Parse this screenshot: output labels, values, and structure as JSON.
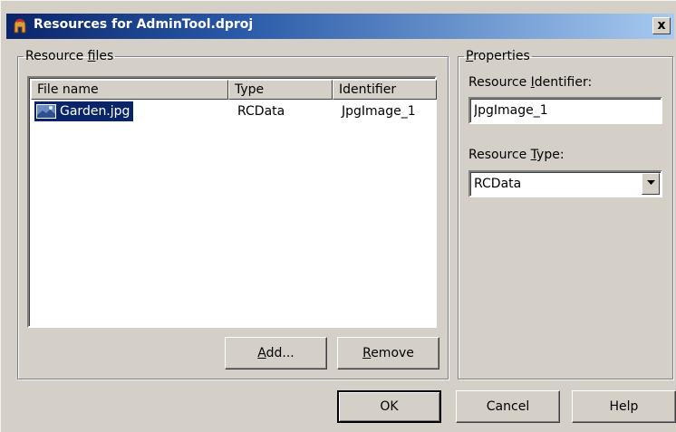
{
  "window": {
    "title": "Resources for AdminTool.dproj",
    "close_label": "x"
  },
  "icons": {
    "app": "spartan-helmet-icon",
    "file": "image-file-icon",
    "dropdown": "chevron-down-icon"
  },
  "resource_files": {
    "legend_pre": "Resource ",
    "legend_key": "f",
    "legend_post": "iles",
    "columns": [
      "File name",
      "Type",
      "Identifier"
    ],
    "rows": [
      {
        "file_name": "Garden.jpg",
        "type": "RCData",
        "identifier": "JpgImage_1",
        "selected": true
      }
    ],
    "add_key": "A",
    "add_rest": "dd...",
    "remove_key": "R",
    "remove_rest": "emove"
  },
  "properties": {
    "legend_key": "P",
    "legend_rest": "roperties",
    "id_label_pre": "Resource ",
    "id_label_key": "I",
    "id_label_post": "dentifier:",
    "id_value": "JpgImage_1",
    "type_label_pre": "Resource ",
    "type_label_key": "T",
    "type_label_post": "ype:",
    "type_value": "RCData"
  },
  "buttons": {
    "ok": "OK",
    "cancel": "Cancel",
    "help": "Help"
  },
  "colors": {
    "title_gradient_start": "#0a246a",
    "title_gradient_end": "#a6caf0",
    "face": "#d4d0c8",
    "selection": "#0a246a"
  }
}
